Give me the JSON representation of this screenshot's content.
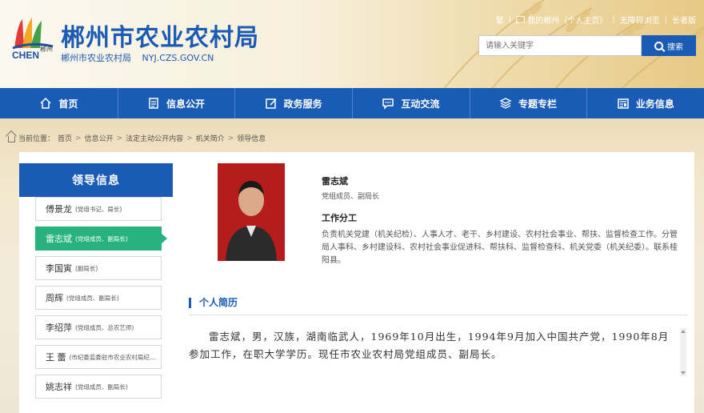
{
  "header": {
    "logo_city": "郴州",
    "logo_en": "CHEN",
    "title": "郴州市农业农村局",
    "subtitle_cn": "郴州市农业农村局",
    "subtitle_url": "NYJ.CZS.GOV.CN",
    "top_links": [
      "繁",
      "我的郴州（个人主页）",
      "无障碍浏览",
      "长者版"
    ],
    "search_placeholder": "请输入关键字",
    "search_button": "搜索"
  },
  "nav": [
    {
      "label": "首页",
      "icon": "home-icon"
    },
    {
      "label": "信息公开",
      "icon": "document-icon"
    },
    {
      "label": "政务服务",
      "icon": "edit-icon"
    },
    {
      "label": "互动交流",
      "icon": "chat-icon"
    },
    {
      "label": "专题专栏",
      "icon": "layers-icon"
    },
    {
      "label": "业务信息",
      "icon": "newspaper-icon"
    }
  ],
  "breadcrumb": {
    "prefix": "当前位置：",
    "items": [
      "首页",
      "信息公开",
      "法定主动公开内容",
      "机关简介",
      "领导信息"
    ]
  },
  "sidebar": {
    "title": "领导信息",
    "leaders": [
      {
        "name": "傅景龙",
        "title": "(党组书记、局长)"
      },
      {
        "name": "雷志斌",
        "title": "(党组成员、副局长)"
      },
      {
        "name": "李国寅",
        "title": "(副局长)"
      },
      {
        "name": "周辉",
        "title": "(党组成员、副局长)"
      },
      {
        "name": "李绍萍",
        "title": "(党组成员、总农艺师)"
      },
      {
        "name": "王 蕾",
        "title": "(市纪委监委驻市农业农村局纪检监察组组长)"
      },
      {
        "name": "姚志祥",
        "title": "(党组成员、副局长)"
      }
    ],
    "active_index": 1
  },
  "profile": {
    "name": "雷志斌",
    "role": "党组成员、副局长",
    "duty_heading": "工作分工",
    "duty_text": "负责机关党建（机关纪检）、人事人才、老干、乡村建设、农村社会事业、帮扶、监督检查工作。分管局人事科、乡村建设科、农村社会事业促进科、帮扶科、监督检查科、机关党委（机关纪委）。联系桂阳县。",
    "bio_heading": "个人简历",
    "bio_text": "雷志斌，男，汉族，湖南临武人，1969年10月出生，1994年9月加入中国共产党，1990年8月参加工作，在职大学学历。现任市农业农村局党组成员、副局长。"
  },
  "colors": {
    "brand_blue": "#1a5bb5",
    "active_green": "#27b27f",
    "photo_bg": "#b21a1a"
  }
}
